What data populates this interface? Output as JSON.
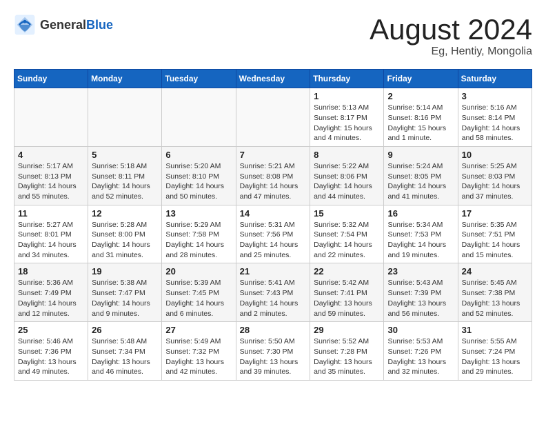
{
  "header": {
    "logo_general": "General",
    "logo_blue": "Blue",
    "month_title": "August 2024",
    "subtitle": "Eg, Hentiy, Mongolia"
  },
  "days_of_week": [
    "Sunday",
    "Monday",
    "Tuesday",
    "Wednesday",
    "Thursday",
    "Friday",
    "Saturday"
  ],
  "weeks": [
    [
      {
        "day": "",
        "info": ""
      },
      {
        "day": "",
        "info": ""
      },
      {
        "day": "",
        "info": ""
      },
      {
        "day": "",
        "info": ""
      },
      {
        "day": "1",
        "info": "Sunrise: 5:13 AM\nSunset: 8:17 PM\nDaylight: 15 hours\nand 4 minutes."
      },
      {
        "day": "2",
        "info": "Sunrise: 5:14 AM\nSunset: 8:16 PM\nDaylight: 15 hours\nand 1 minute."
      },
      {
        "day": "3",
        "info": "Sunrise: 5:16 AM\nSunset: 8:14 PM\nDaylight: 14 hours\nand 58 minutes."
      }
    ],
    [
      {
        "day": "4",
        "info": "Sunrise: 5:17 AM\nSunset: 8:13 PM\nDaylight: 14 hours\nand 55 minutes."
      },
      {
        "day": "5",
        "info": "Sunrise: 5:18 AM\nSunset: 8:11 PM\nDaylight: 14 hours\nand 52 minutes."
      },
      {
        "day": "6",
        "info": "Sunrise: 5:20 AM\nSunset: 8:10 PM\nDaylight: 14 hours\nand 50 minutes."
      },
      {
        "day": "7",
        "info": "Sunrise: 5:21 AM\nSunset: 8:08 PM\nDaylight: 14 hours\nand 47 minutes."
      },
      {
        "day": "8",
        "info": "Sunrise: 5:22 AM\nSunset: 8:06 PM\nDaylight: 14 hours\nand 44 minutes."
      },
      {
        "day": "9",
        "info": "Sunrise: 5:24 AM\nSunset: 8:05 PM\nDaylight: 14 hours\nand 41 minutes."
      },
      {
        "day": "10",
        "info": "Sunrise: 5:25 AM\nSunset: 8:03 PM\nDaylight: 14 hours\nand 37 minutes."
      }
    ],
    [
      {
        "day": "11",
        "info": "Sunrise: 5:27 AM\nSunset: 8:01 PM\nDaylight: 14 hours\nand 34 minutes."
      },
      {
        "day": "12",
        "info": "Sunrise: 5:28 AM\nSunset: 8:00 PM\nDaylight: 14 hours\nand 31 minutes."
      },
      {
        "day": "13",
        "info": "Sunrise: 5:29 AM\nSunset: 7:58 PM\nDaylight: 14 hours\nand 28 minutes."
      },
      {
        "day": "14",
        "info": "Sunrise: 5:31 AM\nSunset: 7:56 PM\nDaylight: 14 hours\nand 25 minutes."
      },
      {
        "day": "15",
        "info": "Sunrise: 5:32 AM\nSunset: 7:54 PM\nDaylight: 14 hours\nand 22 minutes."
      },
      {
        "day": "16",
        "info": "Sunrise: 5:34 AM\nSunset: 7:53 PM\nDaylight: 14 hours\nand 19 minutes."
      },
      {
        "day": "17",
        "info": "Sunrise: 5:35 AM\nSunset: 7:51 PM\nDaylight: 14 hours\nand 15 minutes."
      }
    ],
    [
      {
        "day": "18",
        "info": "Sunrise: 5:36 AM\nSunset: 7:49 PM\nDaylight: 14 hours\nand 12 minutes."
      },
      {
        "day": "19",
        "info": "Sunrise: 5:38 AM\nSunset: 7:47 PM\nDaylight: 14 hours\nand 9 minutes."
      },
      {
        "day": "20",
        "info": "Sunrise: 5:39 AM\nSunset: 7:45 PM\nDaylight: 14 hours\nand 6 minutes."
      },
      {
        "day": "21",
        "info": "Sunrise: 5:41 AM\nSunset: 7:43 PM\nDaylight: 14 hours\nand 2 minutes."
      },
      {
        "day": "22",
        "info": "Sunrise: 5:42 AM\nSunset: 7:41 PM\nDaylight: 13 hours\nand 59 minutes."
      },
      {
        "day": "23",
        "info": "Sunrise: 5:43 AM\nSunset: 7:39 PM\nDaylight: 13 hours\nand 56 minutes."
      },
      {
        "day": "24",
        "info": "Sunrise: 5:45 AM\nSunset: 7:38 PM\nDaylight: 13 hours\nand 52 minutes."
      }
    ],
    [
      {
        "day": "25",
        "info": "Sunrise: 5:46 AM\nSunset: 7:36 PM\nDaylight: 13 hours\nand 49 minutes."
      },
      {
        "day": "26",
        "info": "Sunrise: 5:48 AM\nSunset: 7:34 PM\nDaylight: 13 hours\nand 46 minutes."
      },
      {
        "day": "27",
        "info": "Sunrise: 5:49 AM\nSunset: 7:32 PM\nDaylight: 13 hours\nand 42 minutes."
      },
      {
        "day": "28",
        "info": "Sunrise: 5:50 AM\nSunset: 7:30 PM\nDaylight: 13 hours\nand 39 minutes."
      },
      {
        "day": "29",
        "info": "Sunrise: 5:52 AM\nSunset: 7:28 PM\nDaylight: 13 hours\nand 35 minutes."
      },
      {
        "day": "30",
        "info": "Sunrise: 5:53 AM\nSunset: 7:26 PM\nDaylight: 13 hours\nand 32 minutes."
      },
      {
        "day": "31",
        "info": "Sunrise: 5:55 AM\nSunset: 7:24 PM\nDaylight: 13 hours\nand 29 minutes."
      }
    ]
  ]
}
